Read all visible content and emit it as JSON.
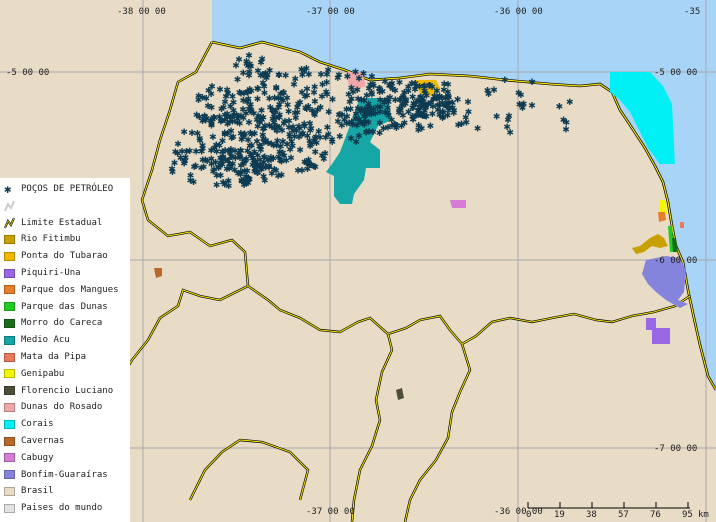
{
  "map": {
    "coordinate_labels": {
      "top_lon": [
        "-38 00 00",
        "-37 00 00",
        "-36 00 00",
        "-35"
      ],
      "bottom_lon": [
        "-37 00 00",
        "-36 00 00"
      ],
      "lat": [
        "-5 00 00",
        "-6 00 00",
        "-7 00 00"
      ],
      "lat_left": [
        "-5 00 00"
      ]
    },
    "colors": {
      "land": "#e8dcc6",
      "sea": "#a8d4f8",
      "grid": "#a9a9a9",
      "border": "#f0e000",
      "border_outline": "#000000",
      "wells": "#0d3b52"
    }
  },
  "legend": {
    "items": [
      {
        "label": "POÇOS DE PETRÓLEO",
        "symbol": "asterisk",
        "color": "#0d3b52"
      },
      {
        "label": "",
        "symbol": "line-blank",
        "color": "#cccccc"
      },
      {
        "label": "Limite Estadual",
        "symbol": "line",
        "color": "#f0e000"
      },
      {
        "label": "Rio Fitimbu",
        "symbol": "box",
        "color": "#c8a000"
      },
      {
        "label": "Ponta do Tubarao",
        "symbol": "box",
        "color": "#f0b800"
      },
      {
        "label": "Piquiri-Una",
        "symbol": "box",
        "color": "#9966e6"
      },
      {
        "label": "Parque dos Mangues",
        "symbol": "box",
        "color": "#e67e2a"
      },
      {
        "label": "Parque das Dunas",
        "symbol": "box",
        "color": "#22cc22"
      },
      {
        "label": "Morro do Careca",
        "symbol": "box",
        "color": "#1a6e1a"
      },
      {
        "label": "Medio Acu",
        "symbol": "box",
        "color": "#17a6a6"
      },
      {
        "label": "Mata da Pipa",
        "symbol": "box",
        "color": "#ec7a5a"
      },
      {
        "label": "Genipabu",
        "symbol": "box",
        "color": "#f5f500"
      },
      {
        "label": "Florencio Luciano",
        "symbol": "box",
        "color": "#4d4d3a"
      },
      {
        "label": "Dunas do Rosado",
        "symbol": "box",
        "color": "#eea8a8"
      },
      {
        "label": "Corais",
        "symbol": "box",
        "color": "#00f0f5"
      },
      {
        "label": "Cavernas",
        "symbol": "box",
        "color": "#b8682a"
      },
      {
        "label": "Cabugy",
        "symbol": "box",
        "color": "#d67bd6"
      },
      {
        "label": "Bonfim-Guaraíras",
        "symbol": "box",
        "color": "#8484dc"
      },
      {
        "label": "Brasil",
        "symbol": "box",
        "color": "#e8dcc6"
      },
      {
        "label": "Paises do mundo",
        "symbol": "box",
        "color": "#e2e2e2"
      }
    ]
  },
  "scale_bar": {
    "ticks": [
      "0",
      "19",
      "38",
      "57",
      "76",
      "95"
    ],
    "unit": "km"
  }
}
